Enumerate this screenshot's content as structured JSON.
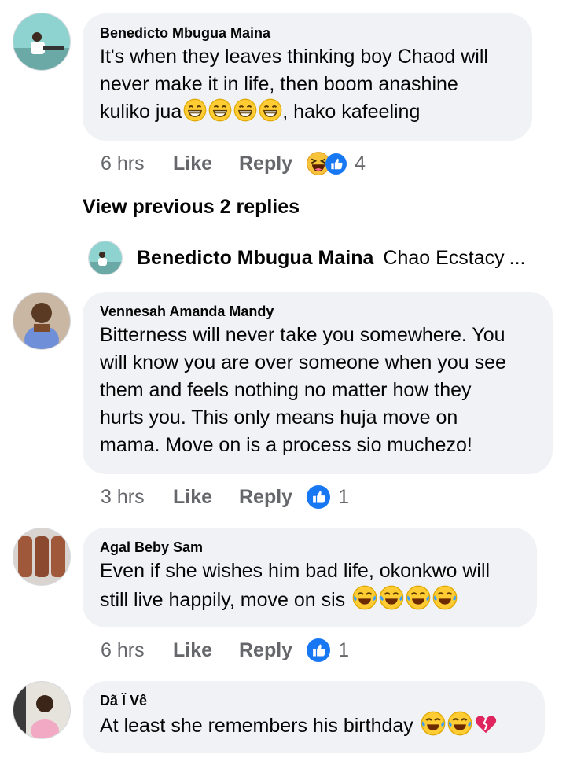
{
  "comments": [
    {
      "author": "Benedicto Mbugua Maina",
      "line1": "It's when they leaves thinking boy Chaod will",
      "line2": "never make it in life, then boom anashine",
      "line3a": "kuliko jua",
      "line3b": ", hako kafeeling",
      "time": "6 hrs",
      "like": "Like",
      "reply": "Reply",
      "reaction_count": "4",
      "emoji_in_text": "grinning-squint-face",
      "reactions": [
        "haha-reaction-icon",
        "like-reaction-icon"
      ]
    },
    {
      "author": "Vennesah Amanda Mandy",
      "line1": "Bitterness will never take you somewhere. You",
      "line2": "will know you are over someone when you see",
      "line3": "them and feels nothing no matter how they",
      "line4": "hurts you. This only means huja move on",
      "line5": "mama. Move on is a process sio muchezo!",
      "time": "3 hrs",
      "like": "Like",
      "reply": "Reply",
      "reaction_count": "1",
      "reactions": [
        "like-reaction-icon"
      ]
    },
    {
      "author": "Agal Beby Sam",
      "line1": "Even if she wishes him bad life, okonkwo will",
      "line2": "still live happily, move on sis",
      "time": "6 hrs",
      "like": "Like",
      "reply": "Reply",
      "reaction_count": "1",
      "emoji_in_text": "tears-of-joy-face",
      "reactions": [
        "like-reaction-icon"
      ]
    },
    {
      "author": "Dã Ï Vê",
      "line1": "At least she remembers his birthday",
      "emoji_in_text": [
        "tears-of-joy-face",
        "tears-of-joy-face",
        "broken-heart"
      ]
    }
  ],
  "view_previous": "View previous 2 replies",
  "reply_preview": {
    "author": "Benedicto Mbugua Maina",
    "text": "Chao Ecstacy",
    "ellipsis": "..."
  },
  "colors": {
    "bubble": "#f0f2f5",
    "meta": "#65676b",
    "like_blue": "#1877f2",
    "haha_yellow": "#f7c33b",
    "heart_red": "#e0245e"
  }
}
